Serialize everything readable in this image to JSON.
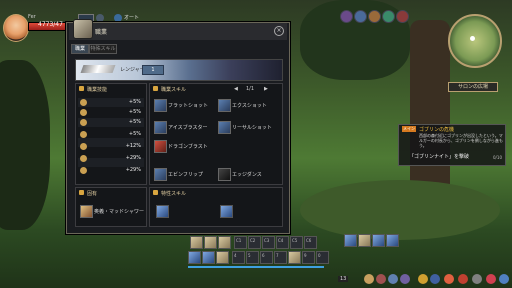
{
  "hud": {
    "level": "Fer",
    "hp": "4773/47"
  },
  "top": {
    "auto": "オート"
  },
  "panel": {
    "title": "職業",
    "tabs": [
      "職業",
      "特殊スキル"
    ],
    "banner": {
      "name": "レンジャー",
      "value": "1"
    },
    "stats": {
      "header": "職業技能",
      "rows": [
        {
          "icon": "heart-icon",
          "value": "+5%"
        },
        {
          "icon": "sword-icon",
          "value": "+5%"
        },
        {
          "icon": "target-icon",
          "value": "+5%"
        },
        {
          "icon": "shield-icon",
          "value": "+5%"
        },
        {
          "icon": "shield-icon",
          "value": "+12%"
        },
        {
          "icon": "shield-icon",
          "value": "+29%"
        },
        {
          "icon": "shield-icon",
          "value": "+29%"
        }
      ]
    },
    "skills": {
      "header": "職業スキル",
      "page": "1/1",
      "list": [
        "フラットショット",
        "エクスショット",
        "アイスブラスター",
        "リーサルショット",
        "ドラゴンブラスト"
      ],
      "list2": [
        "エビンフリップ",
        "エッジダンス"
      ]
    },
    "special": {
      "header": "固有",
      "item": "奥義・マッドシャワー"
    },
    "traits": {
      "header": "特性スキル"
    }
  },
  "quest": {
    "tag": "メイン",
    "title": "ゴブリンの危機",
    "desc": "西部の森付近にゴブリンが出没したという。マルガーの村長から、ゴブリンを倒しながら進もう。",
    "goal": "「ゴブリンナイト」を撃破",
    "count": "0/10"
  },
  "minimap": {
    "button": "サロンの広場"
  },
  "hotkeys": {
    "top": [
      "Q",
      "W",
      "E",
      "C1",
      "C2",
      "C3",
      "C4",
      "C5",
      "C6"
    ],
    "bottom": [
      "1",
      "2",
      "3",
      "4",
      "5",
      "6",
      "7",
      "8",
      "9",
      "0"
    ]
  },
  "menu_count": "13",
  "colors": {
    "accent": "#d9a640",
    "hp": "#e04a3a",
    "panel": "#1a1c20",
    "quest_tag": "#d67a20"
  }
}
